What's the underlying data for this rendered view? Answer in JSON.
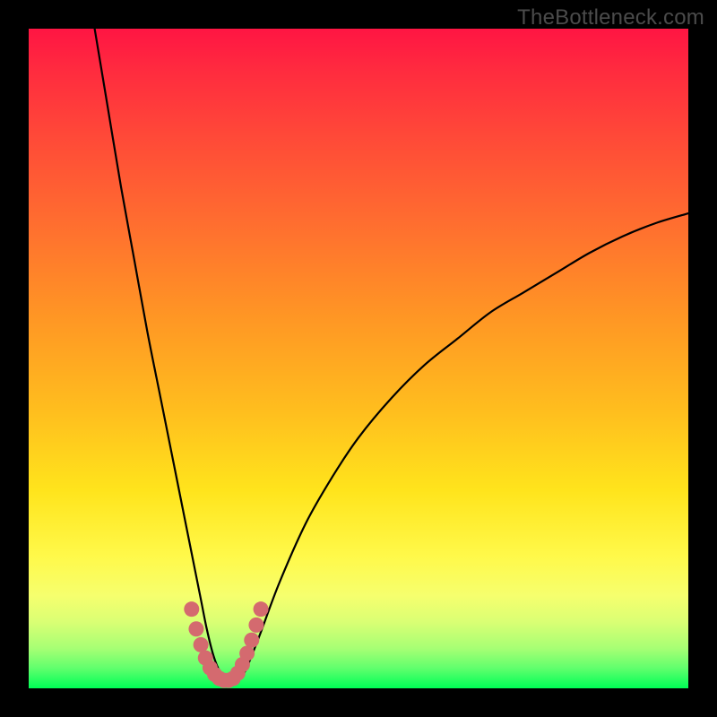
{
  "watermark": "TheBottleneck.com",
  "chart_data": {
    "type": "line",
    "title": "",
    "xlabel": "",
    "ylabel": "",
    "xlim": [
      0,
      100
    ],
    "ylim": [
      0,
      100
    ],
    "series": [
      {
        "name": "curve",
        "x": [
          10,
          12,
          14,
          16,
          18,
          20,
          22,
          24,
          26,
          27,
          28,
          29,
          30,
          31,
          32,
          33,
          35,
          38,
          42,
          46,
          50,
          55,
          60,
          65,
          70,
          75,
          80,
          85,
          90,
          95,
          100
        ],
        "y": [
          100,
          88,
          76,
          65,
          54,
          44,
          34,
          24,
          14,
          9,
          5,
          2.5,
          1.5,
          1.2,
          1.5,
          3,
          8,
          16,
          25,
          32,
          38,
          44,
          49,
          53,
          57,
          60,
          63,
          66,
          68.5,
          70.5,
          72
        ]
      }
    ],
    "highlight": {
      "name": "valley-marker",
      "color": "#d46a6f",
      "x": [
        24.7,
        25.4,
        26.1,
        26.8,
        27.5,
        28.2,
        28.9,
        29.6,
        30.3,
        31.0,
        31.7,
        32.4,
        33.1,
        33.8,
        34.5,
        35.2
      ],
      "y": [
        12.0,
        9.0,
        6.6,
        4.6,
        3.1,
        2.1,
        1.5,
        1.2,
        1.2,
        1.5,
        2.3,
        3.6,
        5.3,
        7.3,
        9.6,
        12.0
      ]
    }
  }
}
